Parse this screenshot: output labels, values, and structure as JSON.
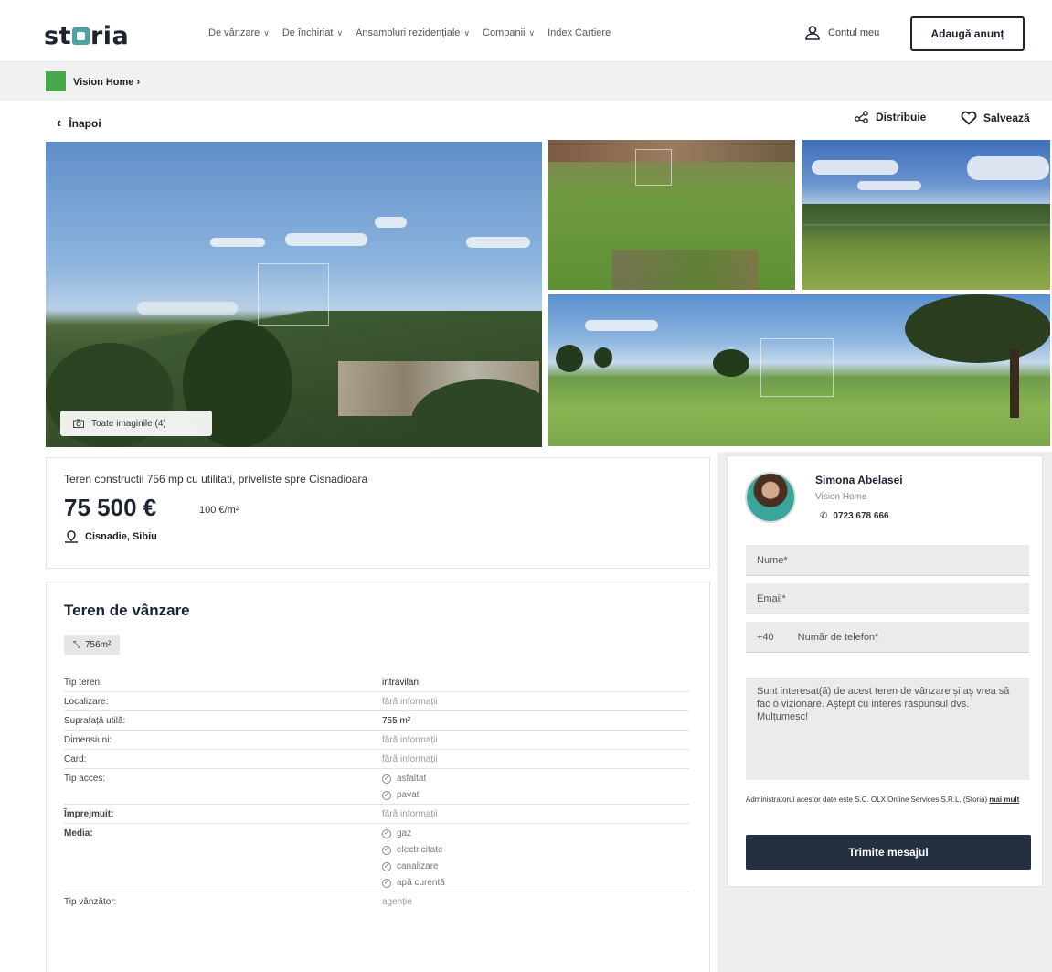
{
  "header": {
    "logo": "storia",
    "nav": [
      {
        "label": "De vânzare",
        "dropdown": true
      },
      {
        "label": "De închiriat",
        "dropdown": true
      },
      {
        "label": "Ansambluri rezidențiale",
        "dropdown": true
      },
      {
        "label": "Companii",
        "dropdown": true
      },
      {
        "label": "Index Cartiere",
        "dropdown": false
      }
    ],
    "account_label": "Contul meu",
    "add_listing_label": "Adaugă anunț"
  },
  "agency_bar": {
    "name": "Vision Home",
    "chevron": "›"
  },
  "actions": {
    "back_label": "Înapoi",
    "share_label": "Distribuie",
    "save_label": "Salvează"
  },
  "gallery": {
    "all_images_label": "Toate imaginile (4)"
  },
  "summary": {
    "title": "Teren constructii 756 mp cu utilitati, priveliste spre Cisnadioara",
    "price": "75 500 €",
    "price_per_m2": "100 €/m²",
    "location": "Cisnadie, Sibiu"
  },
  "details": {
    "heading": "Teren de vânzare",
    "area_chip": "756m²",
    "rows": [
      {
        "label": "Tip teren:",
        "value": "intravilan",
        "muted": false
      },
      {
        "label": "Localizare:",
        "value": "fără informații",
        "muted": true
      },
      {
        "label": "Suprafață utilă:",
        "value": "755 m²",
        "muted": false
      },
      {
        "label": "Dimensiuni:",
        "value": "fără informații",
        "muted": true
      },
      {
        "label": "Card:",
        "value": "fără informații",
        "muted": true
      },
      {
        "label": "Tip acces:",
        "items": [
          "asfaltat",
          "pavat"
        ]
      },
      {
        "label": "Împrejmuit:",
        "value": "fără informații",
        "muted": true,
        "bold_label": true
      },
      {
        "label": "Media:",
        "items": [
          "gaz",
          "electricitate",
          "canalizare",
          "apă curentă"
        ],
        "bold_label": true
      },
      {
        "label": "Tip vânzător:",
        "value": "agenție",
        "muted": true
      }
    ]
  },
  "contact": {
    "agent_name": "Simona Abelasei",
    "agency": "Vision Home",
    "phone": "0723 678 666",
    "name_placeholder": "Nume*",
    "email_placeholder": "Email*",
    "phone_prefix": "+40",
    "phone_placeholder": "Număr de telefon*",
    "message": "Sunt interesat(ă) de acest teren de vânzare și aș vrea să fac o vizionare. Aștept cu interes răspunsul dvs. Mulțumesc!",
    "legal_text": "Administratorul acestor date este S.C. OLX Online Services S.R.L. (Storia)",
    "legal_link": "mai mult",
    "send_label": "Trimite mesajul"
  }
}
